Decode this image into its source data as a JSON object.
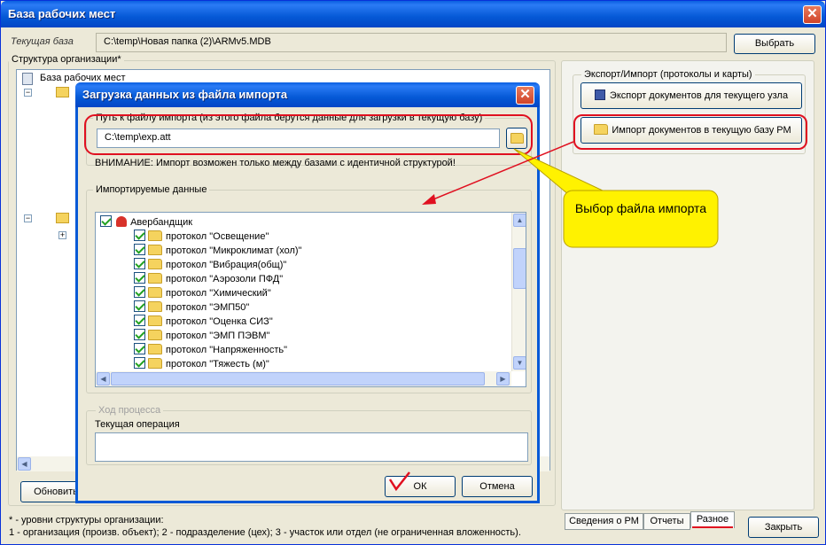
{
  "main_window": {
    "title": "База рабочих мест",
    "current_db_label": "Текущая база",
    "current_db_path": "C:\\temp\\Новая папка (2)\\ARMv5.MDB",
    "choose_button": "Выбрать",
    "structure_group": "Структура организации*",
    "tree_root": "База рабочих мест",
    "refresh_button": "Обновить",
    "export_group": "Экспорт/Импорт (протоколы и карты)",
    "export_button": "Экспорт документов для текущего узла",
    "import_button": "Импорт документов в текущую базу РМ",
    "tabs": [
      "Сведения о РМ",
      "Отчеты",
      "Разное"
    ],
    "close_button": "Закрыть",
    "footnote_1": "* - уровни структуры организации:",
    "footnote_2": "1 - организация (произв. объект); 2 - подразделение (цех); 3 - участок или отдел (не ограниченная вложенность)."
  },
  "dialog": {
    "title": "Загрузка данных из файла импорта",
    "path_group": "Путь к файлу импорта (из этого файла берутся данные для загрузки в текущую базу)",
    "path_value": "C:\\temp\\exp.att",
    "warning": "ВНИМАНИЕ: Импорт возможен только между базами с идентичной структурой!",
    "import_group": "Импортируемые данные",
    "root_item": "Авербандщик",
    "items": [
      "протокол \"Освещение\"",
      "протокол \"Микроклимат (хол)\"",
      "протокол \"Вибрация(общ)\"",
      "протокол \"Аэрозоли ПФД\"",
      "протокол \"Химический\"",
      "протокол \"ЭМП50\"",
      "протокол \"Оценка СИЗ\"",
      "протокол \"ЭМП ПЭВМ\"",
      "протокол \"Напряженность\"",
      "протокол \"Тяжесть (м)\""
    ],
    "progress_group": "Ход процесса",
    "current_op_label": "Текущая операция",
    "ok_button": "ОК",
    "cancel_button": "Отмена"
  },
  "callout": {
    "text": "Выбор файла импорта"
  },
  "colors": {
    "title_blue": "#0559d6",
    "annotation_red": "#e01020",
    "callout_yellow": "#fff200"
  }
}
